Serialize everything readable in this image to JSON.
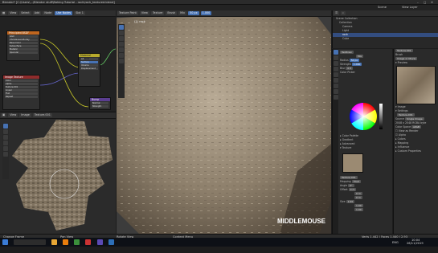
{
  "window": {
    "title": "Blender* [C:\\Users\\...\\Blender stuff\\Baking Tutorial - rock\\rock_textured.blend]"
  },
  "menu": [
    "File",
    "Edit",
    "Render",
    "Window",
    "Help"
  ],
  "workspaces": [
    "Layout",
    "Modeling",
    "Sculpting",
    "UV Editing",
    "Texture Paint",
    "Shading",
    "Animation",
    "Rendering",
    "Compositing",
    "Scripting"
  ],
  "active_workspace": "Texture Paint",
  "scene": {
    "label": "Scene",
    "view_layer": "View Layer"
  },
  "node_editor": {
    "header": [
      "View",
      "Select",
      "Add",
      "Node",
      "Use Nodes"
    ],
    "slot": "Slot 1",
    "nodes": [
      {
        "title": "Principled BSDF",
        "rows": [
          "GGX",
          "Christensen-Burley",
          "Base Color",
          "Subsurface",
          "Metallic",
          "Specular"
        ]
      },
      {
        "title": "Material Output",
        "rows": [
          "All",
          "Surface",
          "Volume",
          "Displacement"
        ]
      },
      {
        "title": "Image Texture",
        "rows": [
          "Color",
          "Alpha",
          "Texture.001",
          "Linear",
          "Flat",
          "Repeat",
          "Single Image"
        ]
      },
      {
        "title": "Bump",
        "rows": [
          "Normal",
          "Strength"
        ]
      }
    ]
  },
  "image_editor": {
    "header": [
      "View",
      "Image"
    ],
    "image_name": "Texture.001"
  },
  "viewport": {
    "header": [
      "Texture Paint",
      "View",
      "Texture",
      "Brush",
      "Mix",
      "Radius",
      "Strength"
    ],
    "brush_mode": "Mix",
    "radius": "50 px",
    "strength": "1.000",
    "object_name": "(1) rock",
    "key_overlay": "MIDDLEMOUSE"
  },
  "outliner": {
    "title": "Scene Collection",
    "items": [
      "Collection",
      "Camera",
      "Light",
      "rock",
      "Cube"
    ],
    "selected": "rock"
  },
  "tool_props": {
    "brush_name": "TexDraw",
    "blend": "Mix",
    "radius_label": "Radius",
    "radius": "50 px",
    "strength_label": "Strength",
    "strength": "1.000",
    "blur_label": "Blur",
    "blur": "0.5",
    "color_picker_label": "Color Picker",
    "sections": [
      "Color Palette",
      "Gradient",
      "Advanced",
      "Texture"
    ],
    "texture_name": "Texture.001",
    "mapping_label": "Mapping",
    "mapping": "Tiled",
    "angle_label": "Angle",
    "angle": "0°",
    "offset_label": "Offset",
    "offset": [
      "0 m",
      "0 m",
      "0 m"
    ],
    "size_label": "Size",
    "size": [
      "1.00",
      "1.00",
      "1.00"
    ]
  },
  "texture_props": {
    "texture_name": "Texture.001",
    "brush_label": "Brush",
    "type_label": "Image or Movie",
    "sections": [
      "Preview",
      "Image",
      "Settings",
      "Colors",
      "Mapping",
      "Influence",
      "Custom Properties"
    ],
    "image_name": "Texture.001",
    "source_label": "Source",
    "source": "Single Image",
    "dimensions": "2048 x 2048 RGBA byte",
    "color_space_label": "Color Space",
    "color_space": "sRGB",
    "alpha_label": "Alpha",
    "view_as_render": "View as Render"
  },
  "statusbar": {
    "left": "Change Frame",
    "middle": "Pan View",
    "right": "Rotate View",
    "context": "Context Menu",
    "stats": "Verts 1,442 | Faces 1,440 | 2.93"
  },
  "taskbar": {
    "time": "10:04",
    "date": "26/11/2019",
    "lang": "ENG"
  },
  "colors": {
    "accent": "#4772b3",
    "header_orange": "#c0661f",
    "header_yellow": "#b8aa2c",
    "header_red": "#8f2c2c"
  }
}
